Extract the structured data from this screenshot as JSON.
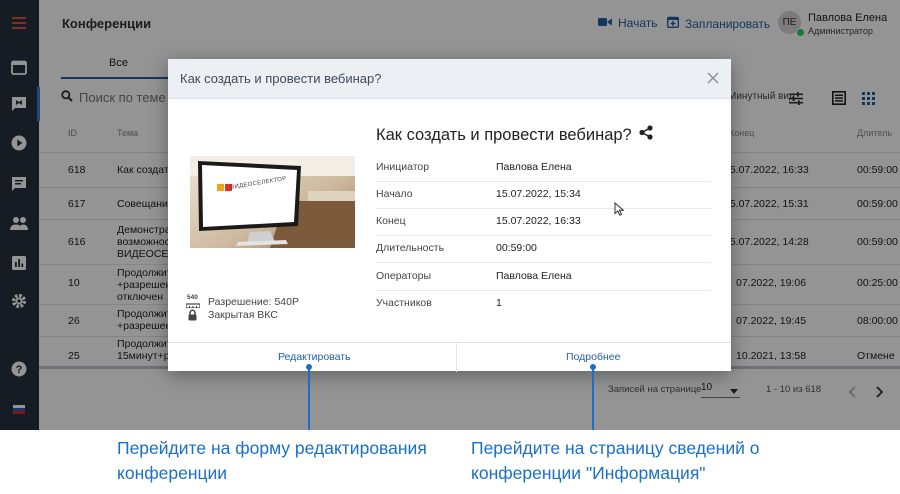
{
  "header": {
    "title": "Конференции",
    "start_label": "Начать",
    "schedule_label": "Запланировать",
    "user": {
      "initials": "ПЕ",
      "name": "Павлова Елена",
      "role": "Администратор"
    }
  },
  "tabs": {
    "all_label": "Все"
  },
  "search": {
    "placeholder": "Поиск по теме"
  },
  "view": {
    "compact_label": "Минутный вид"
  },
  "table": {
    "columns": {
      "id": "ID",
      "theme": "Тема",
      "end": "Конец",
      "duration": "Длитель"
    },
    "rows": [
      {
        "id": "618",
        "theme": "Как создать",
        "end": "15.07.2022, 16:33",
        "duration": "00:59:00"
      },
      {
        "id": "617",
        "theme": "Совещание",
        "end": "15.07.2022, 15:31",
        "duration": "00:59:00"
      },
      {
        "id": "616",
        "theme": "Демонстра\nвозможнос\nВИДЕОСЕЛ",
        "end": "15.07.2022, 14:28",
        "duration": "00:59:00"
      },
      {
        "id": "10",
        "theme": "Продолжит\n+разрешен\nотключен",
        "end": "07.2022, 19:06",
        "duration": "00:25:00"
      },
      {
        "id": "26",
        "theme": "Продолжит\n+разрешен",
        "end": "07.2022, 19:45",
        "duration": "08:00:00"
      },
      {
        "id": "25",
        "theme": "Продолжит\n15минут+р",
        "end": "10.2021, 13:58",
        "duration": "Отмене"
      }
    ]
  },
  "pager": {
    "per_page_label": "Записей на странице",
    "per_page_value": "10",
    "range": "1 - 10 из 618"
  },
  "dialog": {
    "header_title": "Как создать и провести вебинар?",
    "title": "Как создать и провести вебинар?",
    "thumb_brand": "ВИДЕОСЕЛЕКТОР",
    "resolution_badge": "540",
    "resolution": "Разрешение: 540P",
    "access": "Закрытая ВКС",
    "details": [
      {
        "label": "Инициатор",
        "value": "Павлова Елена"
      },
      {
        "label": "Начало",
        "value": "15.07.2022, 15:34"
      },
      {
        "label": "Конец",
        "value": "15.07.2022, 16:33"
      },
      {
        "label": "Длительность",
        "value": "00:59:00"
      },
      {
        "label": "Операторы",
        "value": "Павлова Елена"
      },
      {
        "label": "Участников",
        "value": "1"
      }
    ],
    "edit_label": "Редактировать",
    "more_label": "Подробнее"
  },
  "annotations": {
    "edit_line1": "Перейдите на форму редактирования",
    "edit_line2": "конференции",
    "more_line1": "Перейдите на страницу сведений о",
    "more_line2": "конференции \"Информация\""
  },
  "colors": {
    "accent": "#1f5fa6",
    "sidebar": "#25313f",
    "annotation": "#1a6fc9",
    "status_online": "#2ecc71"
  }
}
